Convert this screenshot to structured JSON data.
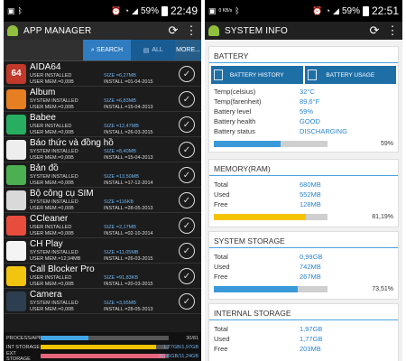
{
  "left": {
    "status": {
      "battery": "59%",
      "time": "22:49"
    },
    "appbar": {
      "title": "APP MANAGER",
      "refresh_icon": "refresh-icon",
      "menu_icon": "overflow-menu-icon"
    },
    "toolbar": {
      "search_label": "SEARCH",
      "all_label": "ALL",
      "more_label": "MORE..."
    },
    "apps": [
      {
        "name": "AIDA64",
        "status": "USER INSTALLED",
        "mem": "USER MEM.=0,00B",
        "size": "SIZE =6,27MB",
        "install": "INSTALL =01-04-2015",
        "icon_text": "64",
        "icon_color": "#c0392b"
      },
      {
        "name": "Album",
        "status": "SYSTEM INSTALLED",
        "mem": "USER MEM.=0,00B",
        "size": "SIZE =6,83MB",
        "install": "INSTALL =15-04-2013",
        "icon_text": "",
        "icon_color": "#e67e22"
      },
      {
        "name": "Babee",
        "status": "USER INSTALLED",
        "mem": "USER MEM.=0,00B",
        "size": "SIZE =12,47MB",
        "install": "INSTALL =26-03-2015",
        "icon_text": "",
        "icon_color": "#27ae60"
      },
      {
        "name": "Báo thức và đồng hồ",
        "status": "SYSTEM INSTALLED",
        "mem": "USER MEM.=0,00B",
        "size": "SIZE =8,40MB",
        "install": "INSTALL =15-04-2013",
        "icon_text": "",
        "icon_color": "#eeeeee"
      },
      {
        "name": "Bản đồ",
        "status": "SYSTEM INSTALLED",
        "mem": "USER MEM.=0,00B",
        "size": "SIZE =13,50MB",
        "install": "INSTALL =17-12-2014",
        "icon_text": "",
        "icon_color": "#4caf50"
      },
      {
        "name": "Bộ công cụ SIM",
        "status": "SYSTEM INSTALLED",
        "mem": "USER MEM.=0,00B",
        "size": "SIZE =116KB",
        "install": "INSTALL =28-05-2013",
        "icon_text": "",
        "icon_color": "#d9d9d9"
      },
      {
        "name": "CCleaner",
        "status": "USER INSTALLED",
        "mem": "USER MEM.=0,00B",
        "size": "SIZE =2,17MB",
        "install": "INSTALL =02-10-2014",
        "icon_text": "",
        "icon_color": "#e74c3c"
      },
      {
        "name": "CH Play",
        "status": "SYSTEM INSTALLED",
        "mem": "USER MEM.=12,94MB",
        "size": "SIZE =11,05MB",
        "install": "INSTALL =26-03-2015",
        "icon_text": "",
        "icon_color": "#f4f4f4"
      },
      {
        "name": "Call Blocker Pro",
        "status": "USER INSTALLED",
        "mem": "USER MEM.=0,00B",
        "size": "SIZE =91,83KB",
        "install": "INSTALL =20-03-2015",
        "icon_text": "",
        "icon_color": "#f1c40f"
      },
      {
        "name": "Camera",
        "status": "SYSTEM INSTALLED",
        "mem": "USER MEM.=0,00B",
        "size": "SIZE =3,95MB",
        "install": "INSTALL =28-05-2013",
        "icon_text": "",
        "icon_color": "#2c3e50"
      }
    ],
    "footer": {
      "process_label": "PROCESS/APP",
      "process_value": "30/81",
      "process_fraction": 0.37,
      "int_label": "INT STORAGE",
      "int_value": "1,77GB/1,97GB",
      "int_fraction": 0.9,
      "ext_label": "EXT STORAGE",
      "ext_value": "10,96GB/11,24GB",
      "ext_fraction": 0.97
    },
    "colors": {
      "process": "#42a5e6",
      "int": "#f5c400",
      "ext": "#e8657c"
    }
  },
  "right": {
    "status": {
      "battery": "59%",
      "time": "22:51",
      "data_speed": "0 KB/s"
    },
    "appbar": {
      "title": "SYSTEM INFO",
      "refresh_icon": "refresh-icon",
      "menu_icon": "overflow-menu-icon"
    },
    "battery": {
      "title": "BATTERY",
      "history_btn": "BATTERY HISTORY",
      "usage_btn": "BATTERY USAGE",
      "rows": [
        {
          "k": "Temp(celsius)",
          "v": "32°C"
        },
        {
          "k": "Temp(farenheit)",
          "v": "89,6°F"
        },
        {
          "k": "Battery level",
          "v": "59%"
        },
        {
          "k": "Battery health",
          "v": "GOOD"
        },
        {
          "k": "Battery status",
          "v": "DISCHARGING"
        }
      ],
      "pct": "59%",
      "fraction": 0.59
    },
    "memory": {
      "title": "MEMORY(RAM)",
      "rows": [
        {
          "k": "Total",
          "v": "680MB"
        },
        {
          "k": "Used",
          "v": "552MB"
        },
        {
          "k": "Free",
          "v": "128MB"
        }
      ],
      "pct": "81,19%",
      "fraction": 0.8119
    },
    "system_storage": {
      "title": "SYSTEM STORAGE",
      "rows": [
        {
          "k": "Total",
          "v": "0,99GB"
        },
        {
          "k": "Used",
          "v": "742MB"
        },
        {
          "k": "Free",
          "v": "267MB"
        }
      ],
      "pct": "73,51%",
      "fraction": 0.7351
    },
    "internal_storage": {
      "title": "INTERNAL STORAGE",
      "rows": [
        {
          "k": "Total",
          "v": "1,97GB"
        },
        {
          "k": "Used",
          "v": "1,77GB"
        },
        {
          "k": "Free",
          "v": "203MB"
        }
      ]
    },
    "colors": {
      "battery": "#3a9ad9",
      "memory": "#f5c400",
      "storage": "#3a9ad9"
    }
  }
}
